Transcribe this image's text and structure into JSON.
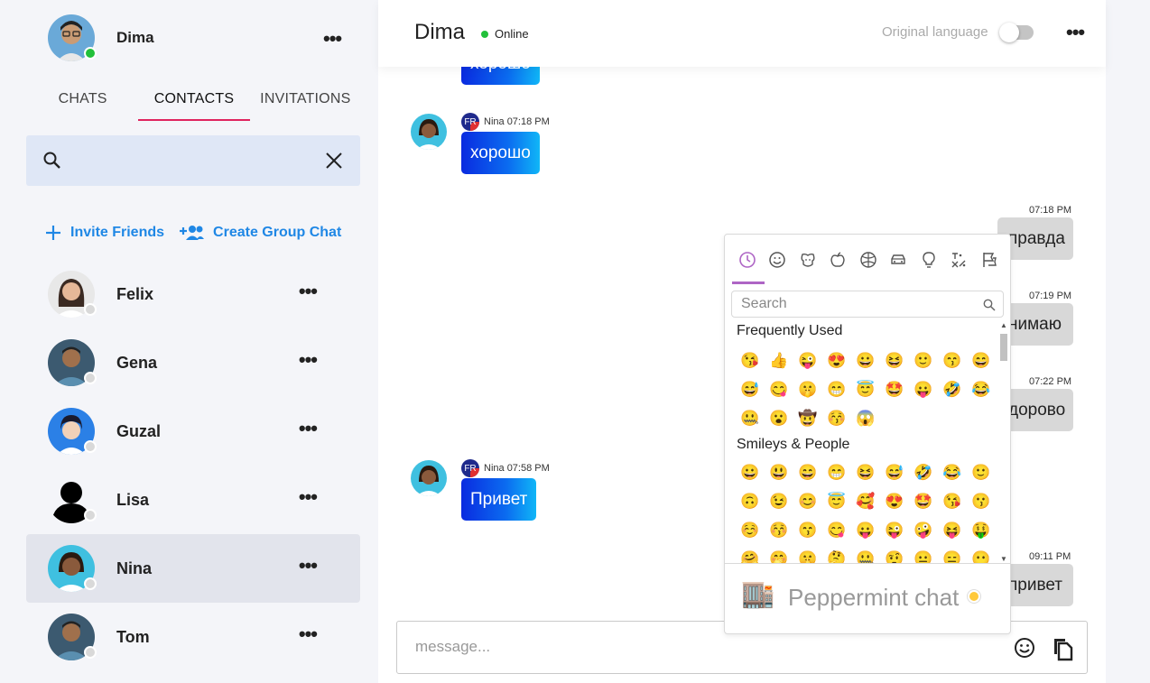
{
  "me": {
    "name": "Dima",
    "status": "online"
  },
  "tabs": [
    {
      "label": "CHATS",
      "active": false
    },
    {
      "label": "CONTACTS",
      "active": true
    },
    {
      "label": "INVITATIONS",
      "active": false
    }
  ],
  "search": {
    "placeholder": "",
    "value": ""
  },
  "actions": {
    "invite": "Invite Friends",
    "group": "Create Group Chat"
  },
  "contacts": [
    {
      "name": "Felix",
      "status": "offline",
      "selected": false
    },
    {
      "name": "Gena",
      "status": "offline",
      "selected": false
    },
    {
      "name": "Guzal",
      "status": "offline",
      "selected": false
    },
    {
      "name": "Lisa",
      "status": "offline",
      "selected": false
    },
    {
      "name": "Nina",
      "status": "offline",
      "selected": true
    },
    {
      "name": "Tom",
      "status": "offline",
      "selected": false
    }
  ],
  "chat": {
    "title": "Dima",
    "online_label": "Online",
    "original_language_label": "Original language",
    "original_language_on": false
  },
  "messages": {
    "top_partial": "хорошо",
    "m1": {
      "sender": "Nina",
      "time": "07:18 PM",
      "flag": "FR",
      "text": "хорошо"
    },
    "o1": {
      "time": "07:18 PM",
      "text": "правда"
    },
    "o2": {
      "time": "07:19 PM",
      "text": "нимаю"
    },
    "o3": {
      "time": "07:22 PM",
      "text": "дорово"
    },
    "m2": {
      "sender": "Nina",
      "time": "07:58 PM",
      "flag": "FR",
      "text": "Привет"
    },
    "o4": {
      "time": "09:11 PM",
      "text": "привет"
    }
  },
  "composer": {
    "placeholder": "message..."
  },
  "emoji_picker": {
    "categories": [
      "recent-icon",
      "smiley-icon",
      "animal-icon",
      "food-icon",
      "activity-icon",
      "travel-icon",
      "objects-icon",
      "symbols-icon",
      "flags-icon"
    ],
    "search_placeholder": "Search",
    "frequently_used_title": "Frequently Used",
    "frequently_used": [
      [
        "😘",
        "👍",
        "😜",
        "😍",
        "😀",
        "😆",
        "🙂",
        "😙",
        "😄"
      ],
      [
        "😅",
        "😋",
        "🤫",
        "😁",
        "😇",
        "🤩",
        "😛",
        "🤣",
        "😂"
      ],
      [
        "🤐",
        "😮",
        "🤠",
        "😚",
        "😱"
      ]
    ],
    "smileys_title": "Smileys & People",
    "smileys": [
      [
        "😀",
        "😃",
        "😄",
        "😁",
        "😆",
        "😅",
        "🤣",
        "😂",
        "🙂"
      ],
      [
        "🙃",
        "😉",
        "😊",
        "😇",
        "🥰",
        "😍",
        "🤩",
        "😘",
        "😗"
      ],
      [
        "☺️",
        "😚",
        "😙",
        "😋",
        "😛",
        "😜",
        "🤪",
        "😝",
        "🤑"
      ],
      [
        "🤗",
        "🤭",
        "🤫",
        "🤔",
        "🤐",
        "🤨",
        "😐",
        "😑",
        "😶"
      ]
    ],
    "preview_emoji": "🏬",
    "preview_title": "Peppermint chat"
  },
  "colors": {
    "accent": "#1f87e5",
    "tab_underline": "#e0245e",
    "online": "#22c03a"
  }
}
